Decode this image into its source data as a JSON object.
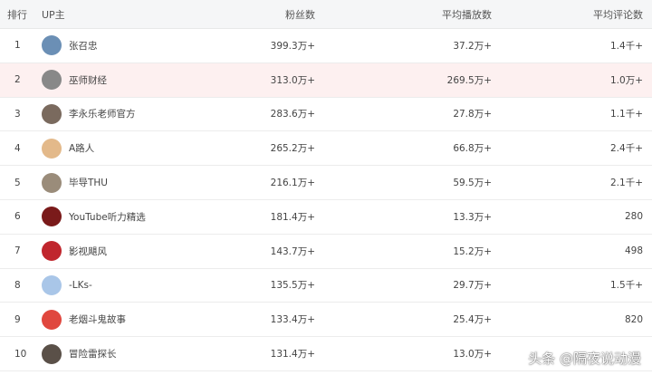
{
  "header": {
    "rank": "排行",
    "up": "UP主",
    "fans": "粉丝数",
    "plays": "平均播放数",
    "comments": "平均评论数"
  },
  "rows": [
    {
      "rank": "1",
      "name": "张召忠",
      "fans": "399.3万+",
      "plays": "37.2万+",
      "comments": "1.4千+",
      "avatar_color": "#6b8fb5",
      "highlight": false
    },
    {
      "rank": "2",
      "name": "巫师财经",
      "fans": "313.0万+",
      "plays": "269.5万+",
      "comments": "1.0万+",
      "avatar_color": "#888888",
      "highlight": true
    },
    {
      "rank": "3",
      "name": "李永乐老师官方",
      "fans": "283.6万+",
      "plays": "27.8万+",
      "comments": "1.1千+",
      "avatar_color": "#7a6a5e",
      "highlight": false
    },
    {
      "rank": "4",
      "name": "A路人",
      "fans": "265.2万+",
      "plays": "66.8万+",
      "comments": "2.4千+",
      "avatar_color": "#e3b98a",
      "highlight": false
    },
    {
      "rank": "5",
      "name": "毕导THU",
      "fans": "216.1万+",
      "plays": "59.5万+",
      "comments": "2.1千+",
      "avatar_color": "#9a8c7a",
      "highlight": false
    },
    {
      "rank": "6",
      "name": "YouTube听力精选",
      "fans": "181.4万+",
      "plays": "13.3万+",
      "comments": "280",
      "avatar_color": "#7a1a1a",
      "highlight": false
    },
    {
      "rank": "7",
      "name": "影视飓风",
      "fans": "143.7万+",
      "plays": "15.2万+",
      "comments": "498",
      "avatar_color": "#c0262d",
      "highlight": false
    },
    {
      "rank": "8",
      "name": "-LKs-",
      "fans": "135.5万+",
      "plays": "29.7万+",
      "comments": "1.5千+",
      "avatar_color": "#a9c6e8",
      "highlight": false
    },
    {
      "rank": "9",
      "name": "老烟斗鬼故事",
      "fans": "133.4万+",
      "plays": "25.4万+",
      "comments": "820",
      "avatar_color": "#e0473e",
      "highlight": false
    },
    {
      "rank": "10",
      "name": "冒险雷探长",
      "fans": "131.4万+",
      "plays": "13.0万+",
      "comments": "",
      "avatar_color": "#5a5048",
      "highlight": false
    }
  ],
  "watermark": "头条 @隔夜说动漫"
}
